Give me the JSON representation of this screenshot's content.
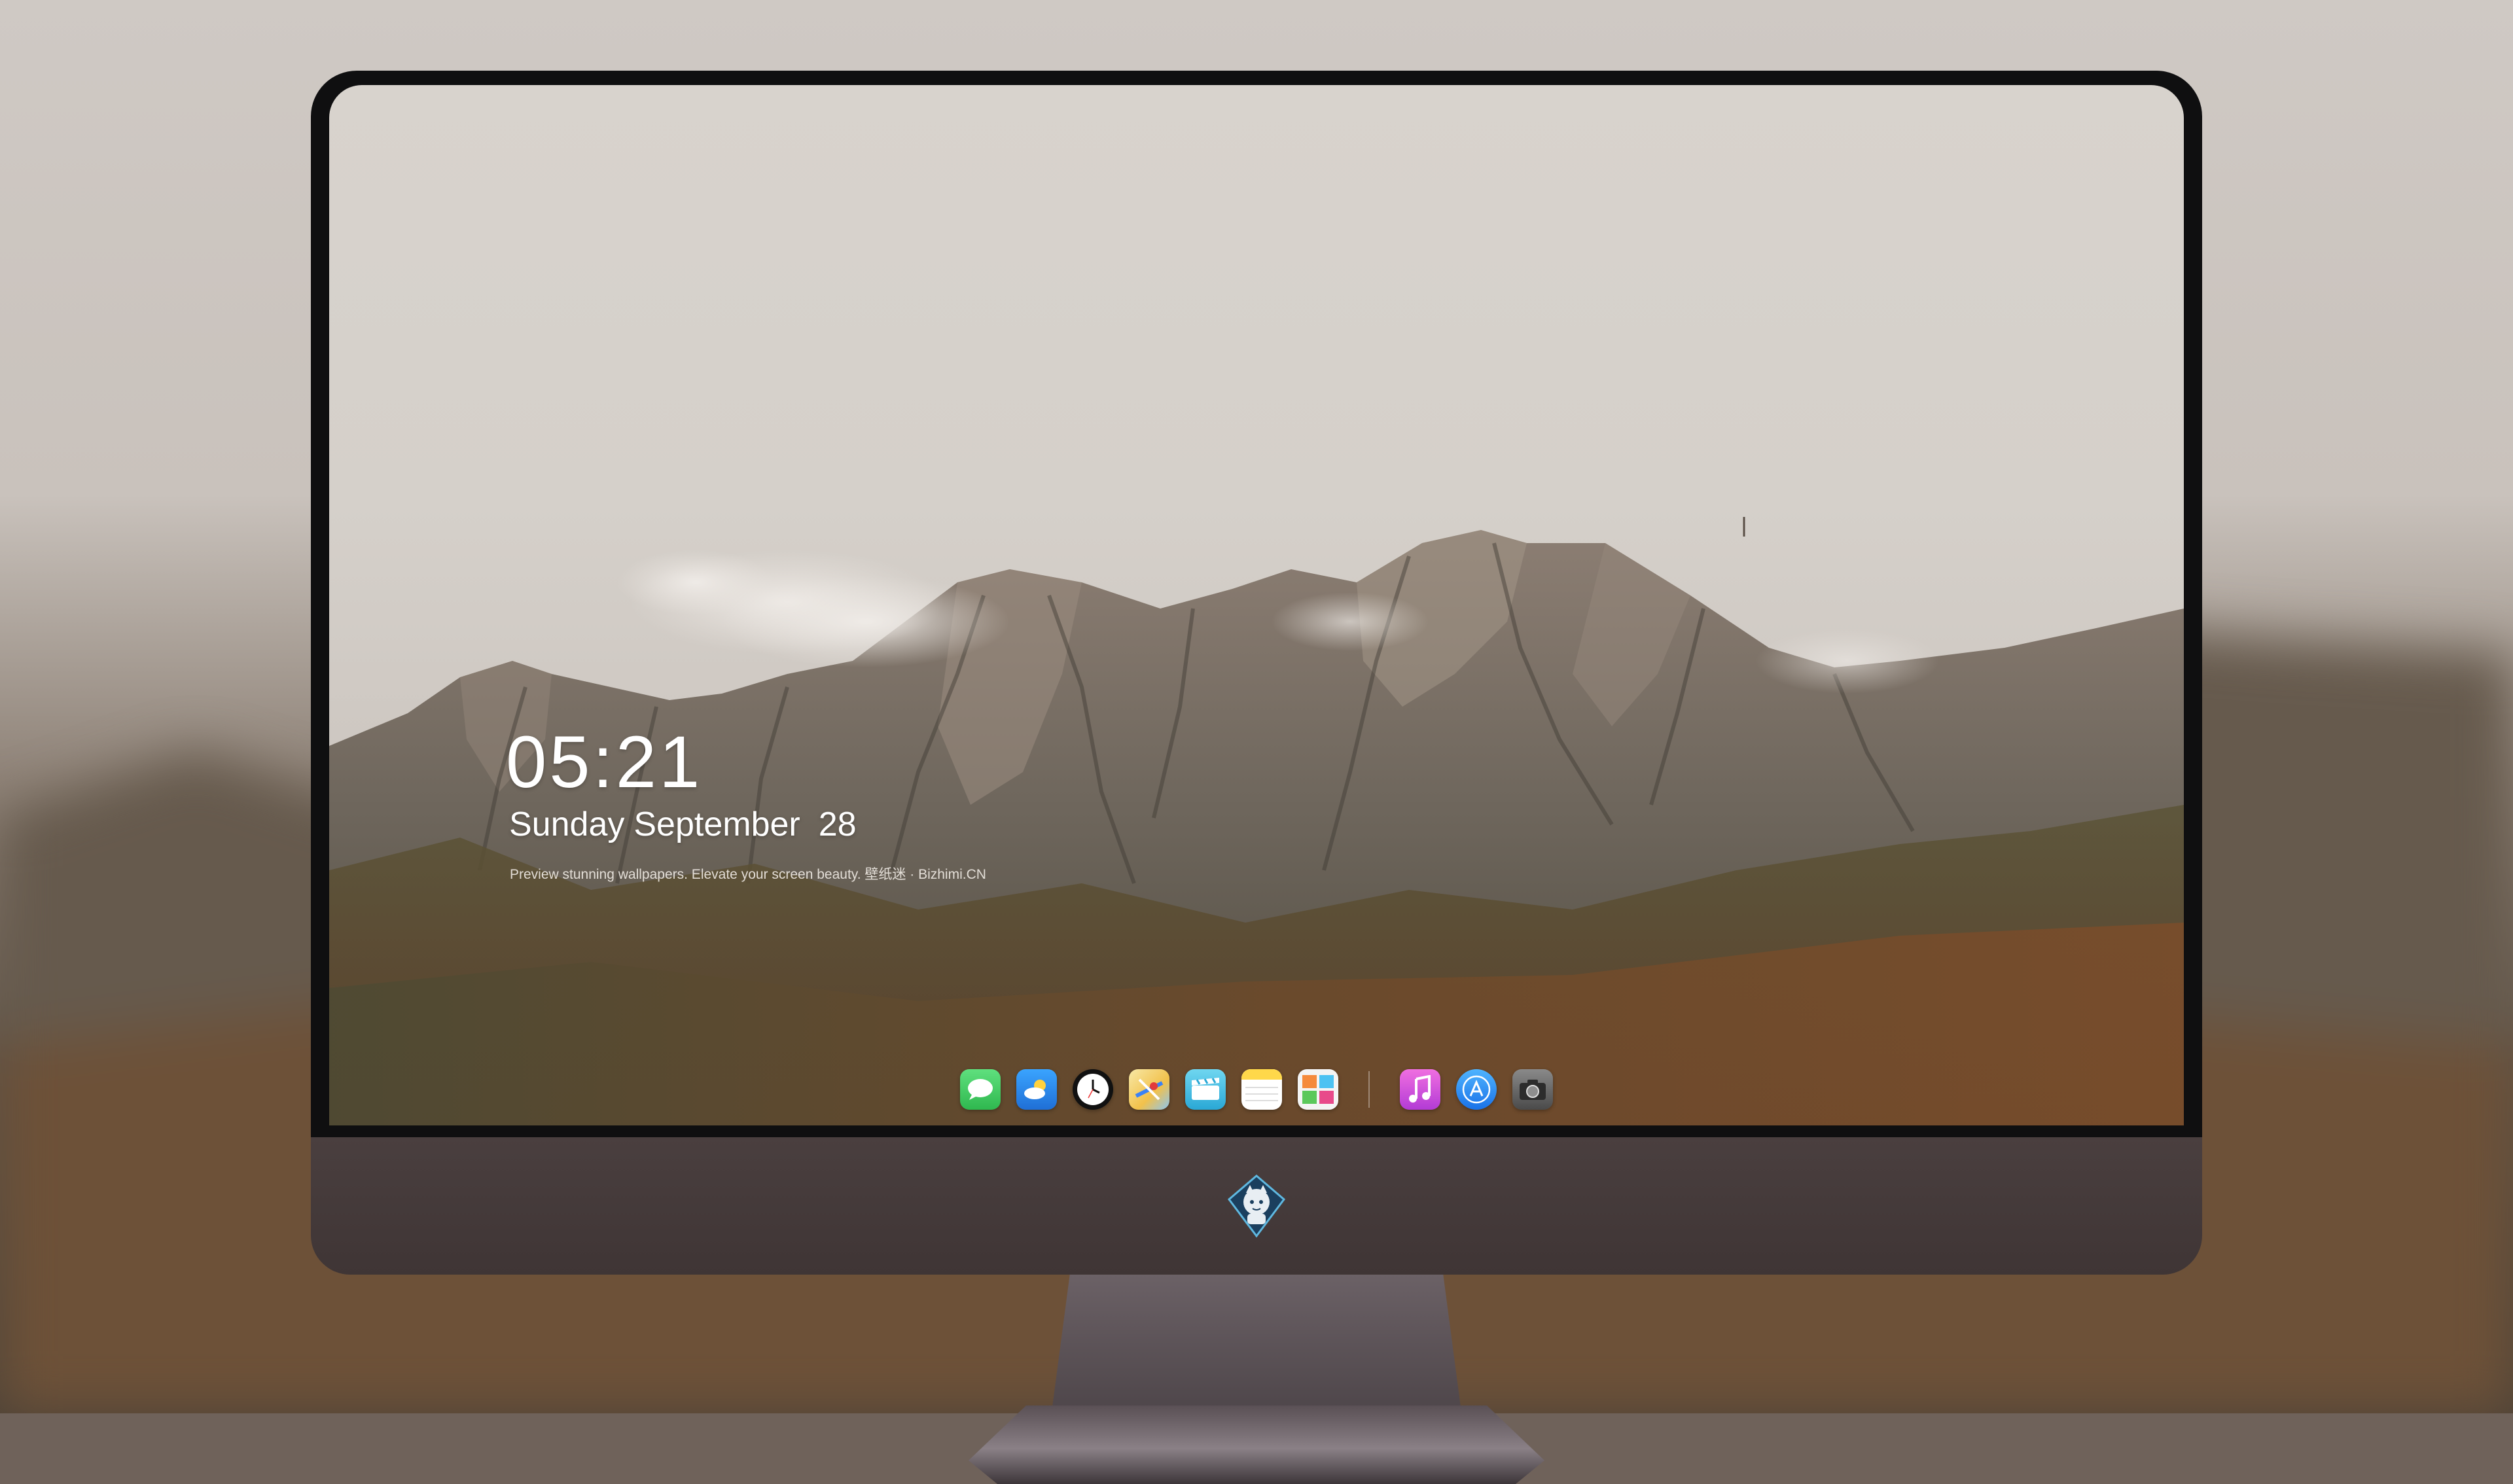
{
  "lock_screen": {
    "time": "05:21",
    "weekday": "Sunday",
    "month": "September",
    "day": "28",
    "tagline": "Preview stunning wallpapers. Elevate your screen beauty. 壁纸迷 · Bizhimi.CN"
  },
  "dock": {
    "apps": [
      {
        "name": "messages-icon",
        "color": "#34c759"
      },
      {
        "name": "weather-icon",
        "color": "#2f8cf0"
      },
      {
        "name": "clock-icon",
        "color": "#111111"
      },
      {
        "name": "maps-icon",
        "color": "#f5c542"
      },
      {
        "name": "clips-icon",
        "color": "#4fc3e8"
      },
      {
        "name": "notes-icon",
        "color": "#ffd84a"
      },
      {
        "name": "photos-app-icon",
        "color": "#f2f2f2"
      },
      {
        "name": "itunes-icon",
        "color": "#e04bd8"
      },
      {
        "name": "app-store-icon",
        "color": "#1e90ff"
      },
      {
        "name": "camera-icon",
        "color": "#5e5e5e"
      }
    ]
  },
  "monitor": {
    "chin_color": "#433939",
    "bezel_color": "#0f0f10"
  }
}
